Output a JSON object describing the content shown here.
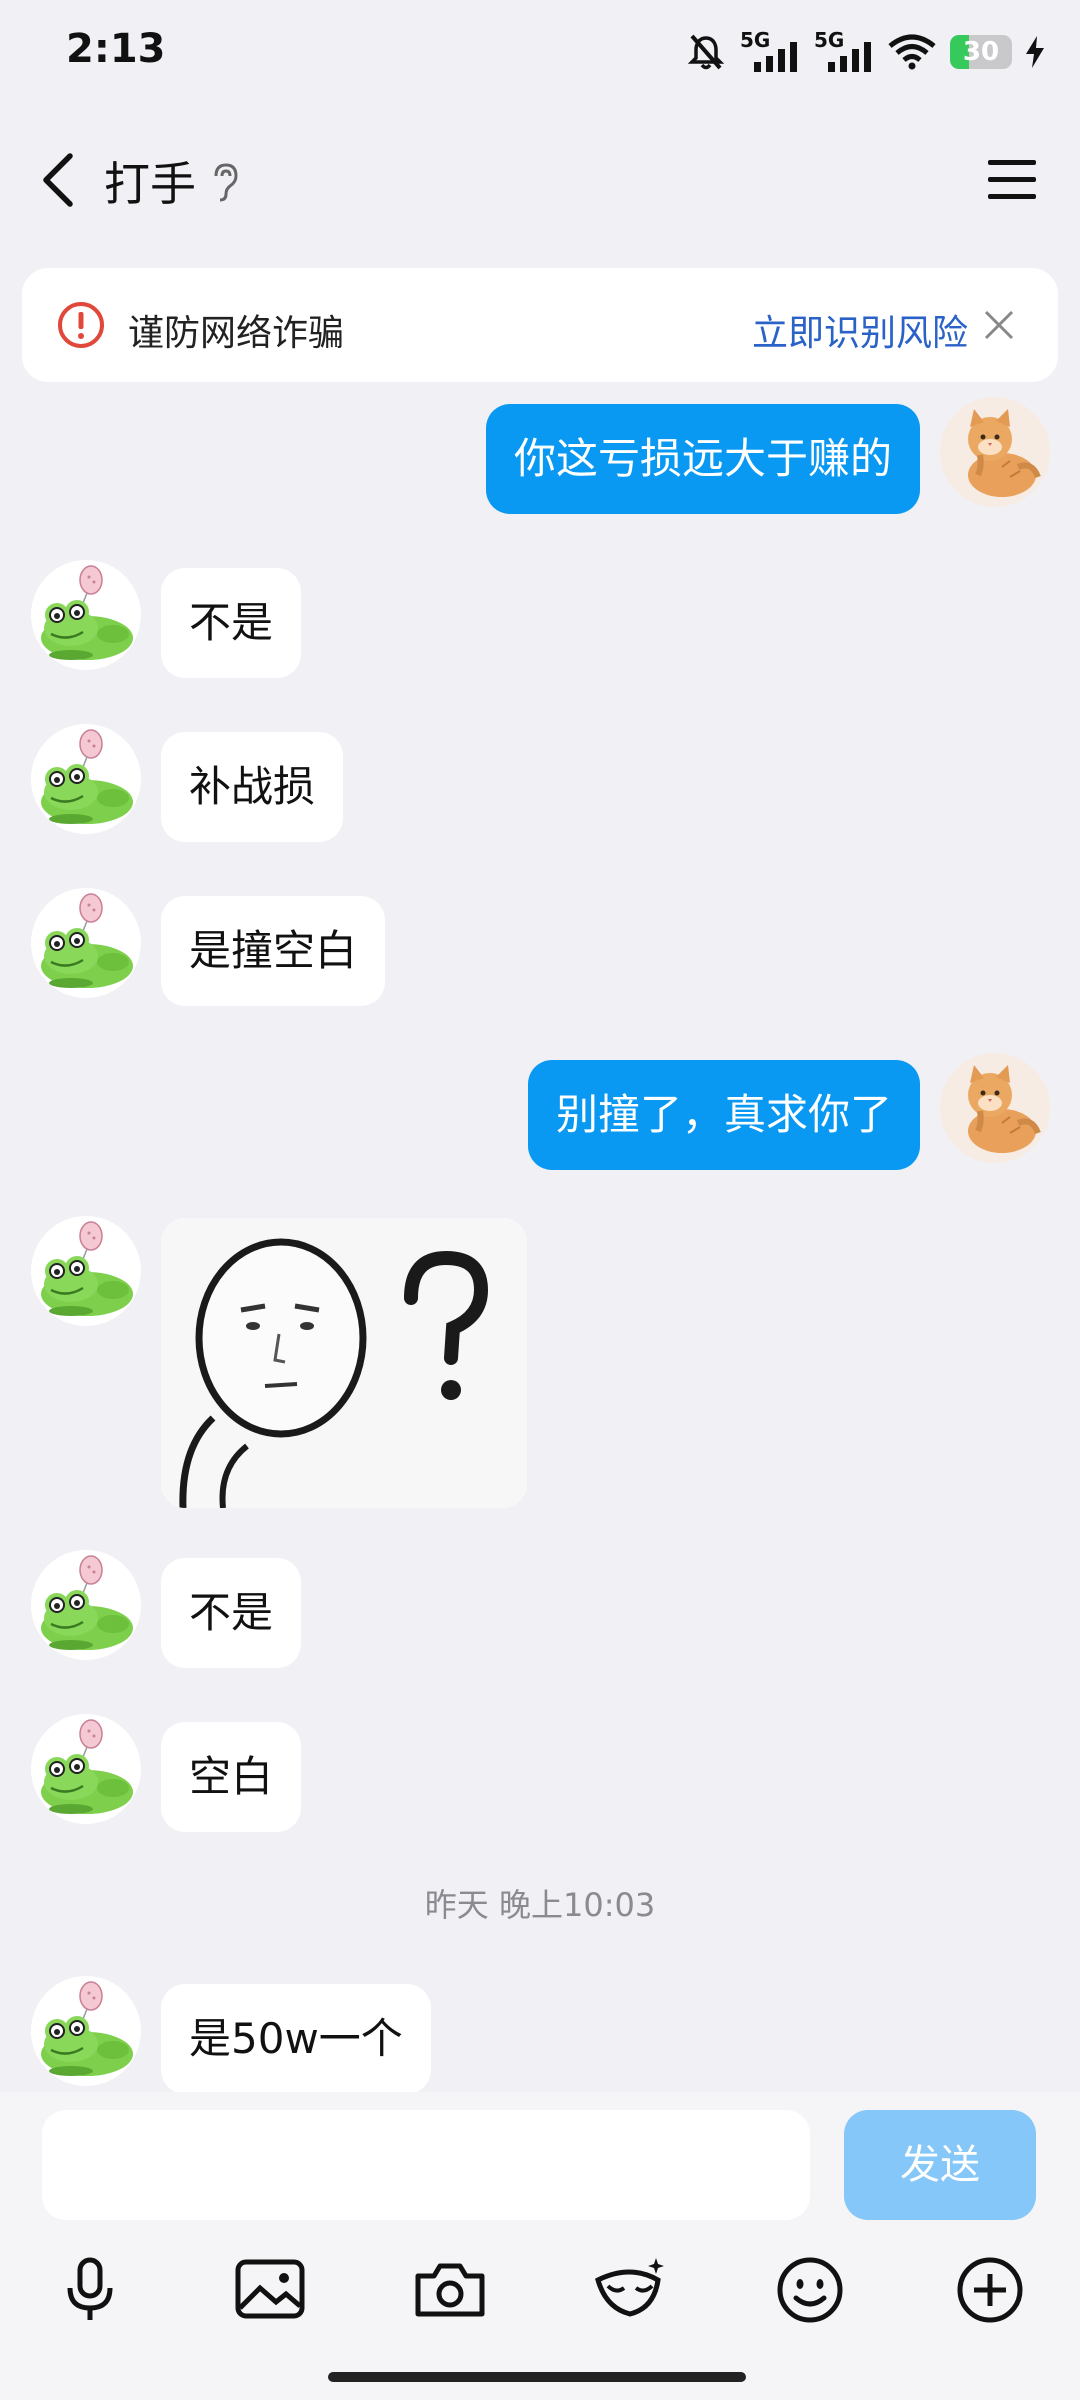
{
  "status_bar": {
    "time": "2:13",
    "network_1": "5G",
    "network_2": "5G",
    "battery": "30",
    "battery_level_percent": 30
  },
  "header": {
    "title": "打手"
  },
  "fraud_banner": {
    "text": "谨防网络诈骗",
    "link": "立即识别风险"
  },
  "messages": [
    {
      "side": "out",
      "text": "你这亏损远大于赚的"
    },
    {
      "side": "in",
      "text": "不是"
    },
    {
      "side": "in",
      "text": "补战损"
    },
    {
      "side": "in",
      "text": "是撞空白"
    },
    {
      "side": "out",
      "text": "别撞了，真求你了"
    },
    {
      "side": "in",
      "type": "sticker",
      "sticker": "confused-face-sticker"
    },
    {
      "side": "in",
      "text": "不是"
    },
    {
      "side": "in",
      "text": "空白"
    },
    {
      "side": "in",
      "text": "是50w一个"
    }
  ],
  "timestamp": "昨天 晚上10:03",
  "input": {
    "send_label": "发送"
  },
  "colors": {
    "outgoing_bubble": "#0a99f2",
    "send_button": "#84c7f8",
    "link": "#2a62c8",
    "warning": "#e0483c"
  }
}
